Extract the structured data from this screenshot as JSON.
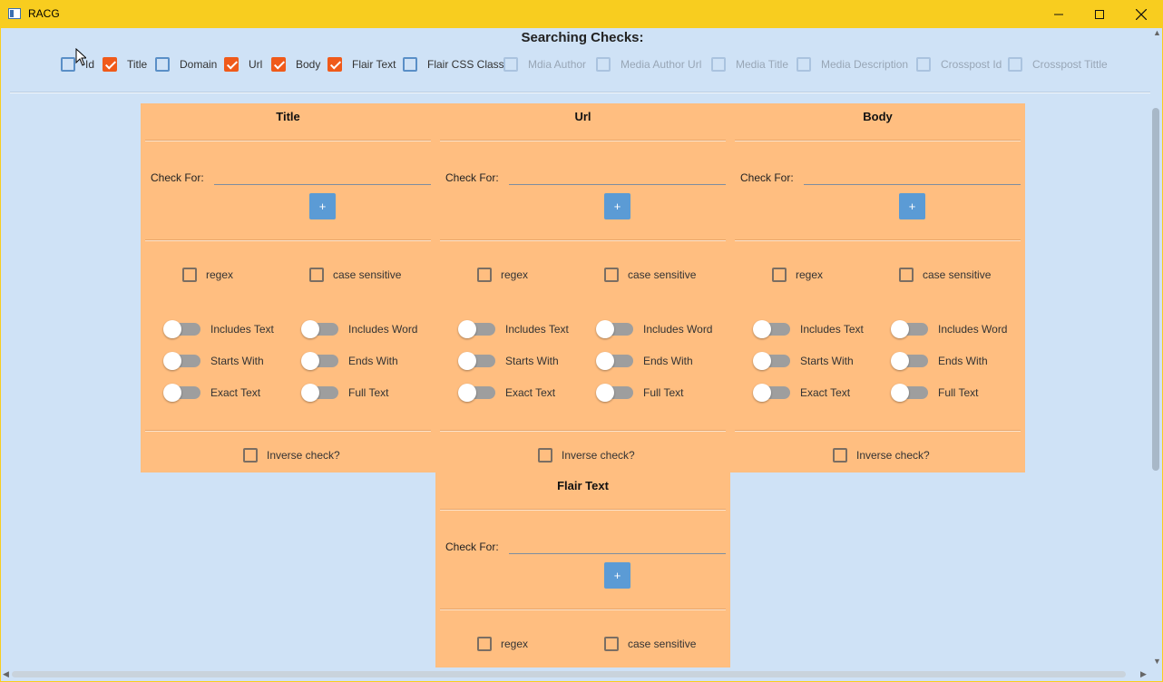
{
  "window": {
    "title": "RACG"
  },
  "heading": "Searching Checks:",
  "checks": [
    {
      "label": "Id",
      "checked": false,
      "enabled": true
    },
    {
      "label": "Title",
      "checked": true,
      "enabled": true
    },
    {
      "label": "Domain",
      "checked": false,
      "enabled": true
    },
    {
      "label": "Url",
      "checked": true,
      "enabled": true
    },
    {
      "label": "Body",
      "checked": true,
      "enabled": true
    },
    {
      "label": "Flair Text",
      "checked": true,
      "enabled": true
    },
    {
      "label": "Flair CSS Class",
      "checked": false,
      "enabled": true
    },
    {
      "label": "Mdia Author",
      "checked": false,
      "enabled": false
    },
    {
      "label": "Media Author Url",
      "checked": false,
      "enabled": false
    },
    {
      "label": "Media Title",
      "checked": false,
      "enabled": false
    },
    {
      "label": "Media Description",
      "checked": false,
      "enabled": false
    },
    {
      "label": "Crosspost Id",
      "checked": false,
      "enabled": false
    },
    {
      "label": "Crosspost Tittle",
      "checked": false,
      "enabled": false
    }
  ],
  "common": {
    "check_for": "Check For:",
    "plus": "+",
    "regex": "regex",
    "case_sensitive": "case sensitive",
    "includes_text": "Includes Text",
    "includes_word": "Includes Word",
    "starts_with": "Starts With",
    "ends_with": "Ends With",
    "exact_text": "Exact Text",
    "full_text": "Full Text",
    "inverse": "Inverse check?"
  },
  "panels": [
    {
      "title": "Title"
    },
    {
      "title": "Url"
    },
    {
      "title": "Body"
    },
    {
      "title": "Flair Text"
    }
  ],
  "colors": {
    "titlebar": "#f8cd1f",
    "background": "#cfe2f6",
    "panel": "#ffbe80",
    "checked": "#f05a1a",
    "button": "#5b9bd5"
  }
}
